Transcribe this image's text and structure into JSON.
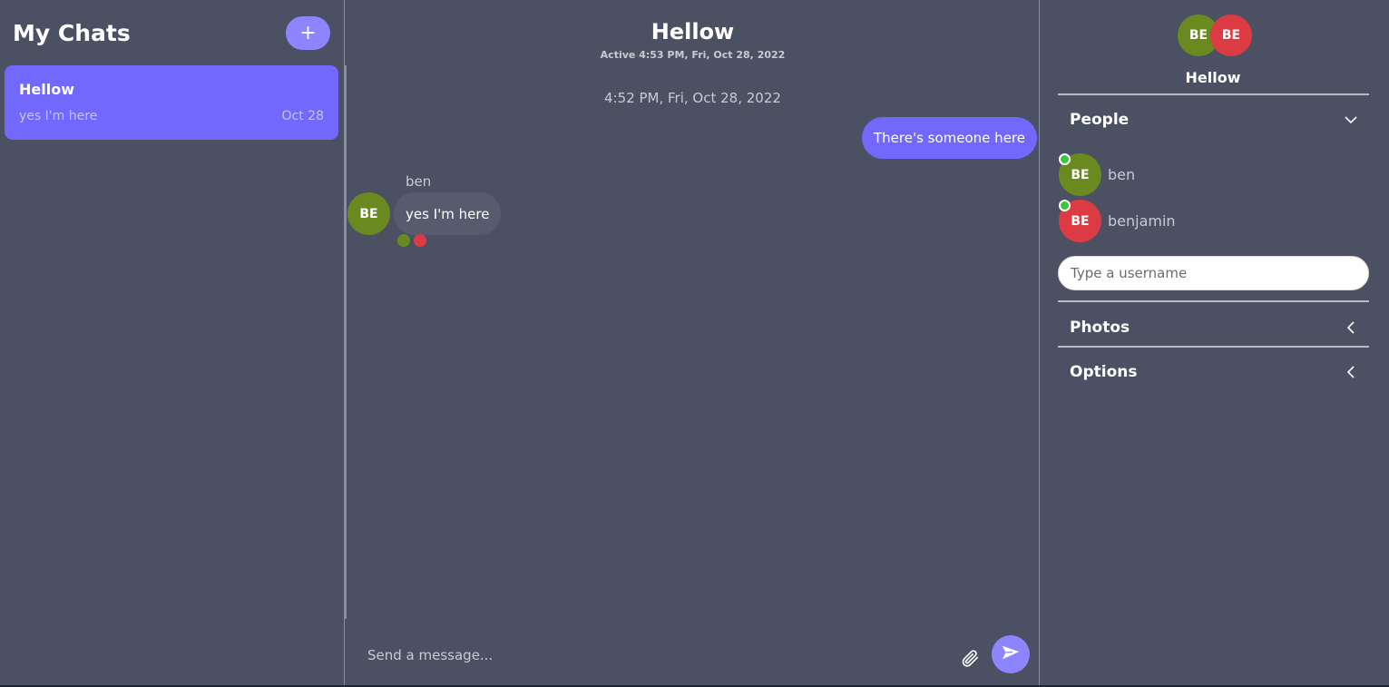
{
  "sidebar": {
    "title": "My Chats",
    "new_chat_label": "+",
    "chats": [
      {
        "title": "Hellow",
        "preview": "yes I'm here",
        "date": "Oct 28"
      }
    ]
  },
  "chat": {
    "title": "Hellow",
    "status": "Active 4:53 PM, Fri, Oct 28, 2022",
    "timestamp": "4:52 PM, Fri, Oct 28, 2022",
    "messages": [
      {
        "sender": "me",
        "text": "There's someone here"
      },
      {
        "sender": "ben",
        "avatar": "BE",
        "text": "yes I'm here"
      }
    ],
    "composer_placeholder": "Send a message..."
  },
  "details": {
    "avatars": [
      "BE",
      "BE"
    ],
    "title": "Hellow",
    "people_label": "People",
    "people": [
      {
        "initials": "BE",
        "name": "ben"
      },
      {
        "initials": "BE",
        "name": "benjamin"
      }
    ],
    "username_placeholder": "Type a username",
    "photos_label": "Photos",
    "options_label": "Options"
  },
  "colors": {
    "background": "#4b5163",
    "accent": "#7268fd",
    "accent_light": "#8c85ff",
    "avatar_green": "#6a8a1f",
    "avatar_red": "#dc3b44",
    "online": "#3cc53c"
  },
  "icons": {
    "new_chat": "plus-icon",
    "attach": "paperclip-icon",
    "send": "send-icon",
    "people_toggle": "chevron-down-icon",
    "photos_toggle": "chevron-left-icon",
    "options_toggle": "chevron-left-icon"
  }
}
